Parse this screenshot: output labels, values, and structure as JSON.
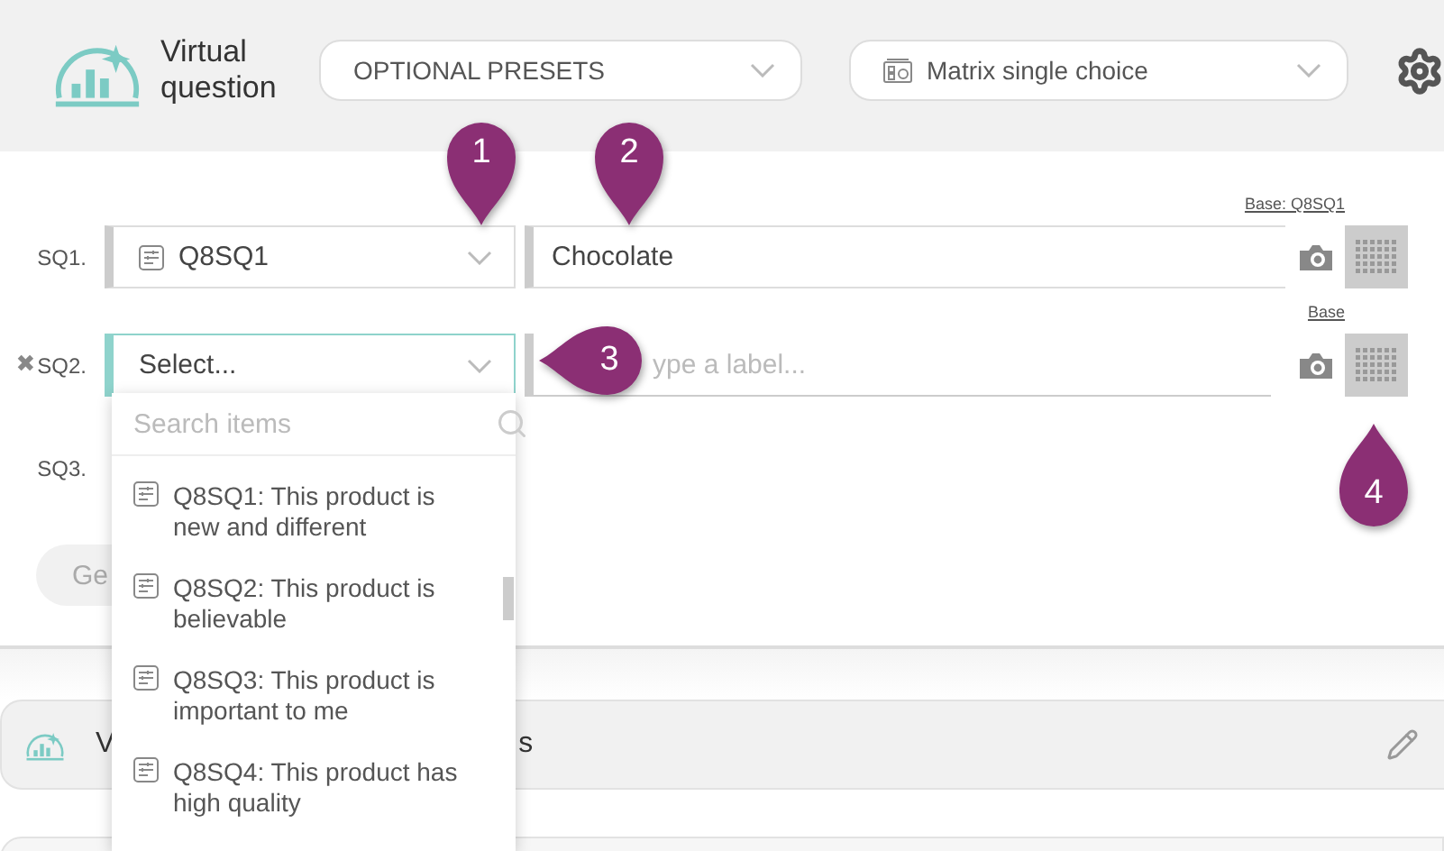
{
  "header": {
    "title": "Virtual question",
    "presets": {
      "placeholder": "OPTIONAL PRESETS"
    },
    "type_select": {
      "value": "Matrix single choice"
    }
  },
  "rows": [
    {
      "kind": "full",
      "label": "SQ1.",
      "focused": false,
      "base": "Base: Q8SQ1",
      "select": {
        "value": "Q8SQ1"
      },
      "field": {
        "value": "Chocolate"
      }
    },
    {
      "kind": "full",
      "label": "SQ2.",
      "remove": "✖",
      "focused": true,
      "base": "Base",
      "select": {
        "placeholder": "Select..."
      },
      "field": {
        "placeholder": "ype a label..."
      }
    },
    {
      "kind": "empty",
      "label": "SQ3."
    }
  ],
  "generate_button": "Ge",
  "dropdown": {
    "search": {
      "placeholder": "Search items"
    },
    "items": [
      {
        "label": "Q8SQ1: This product is new and different"
      },
      {
        "label": "Q8SQ2: This product is believable"
      },
      {
        "label": "Q8SQ3: This product is important to me"
      },
      {
        "label": "Q8SQ4: This product has high quality"
      }
    ]
  },
  "section": {
    "title_start": "V",
    "title_end": "s"
  },
  "markers": [
    {
      "number": "1",
      "kind": "down"
    },
    {
      "number": "2",
      "kind": "down"
    },
    {
      "number": "3",
      "kind": "left"
    },
    {
      "number": "4",
      "kind": "up"
    }
  ]
}
